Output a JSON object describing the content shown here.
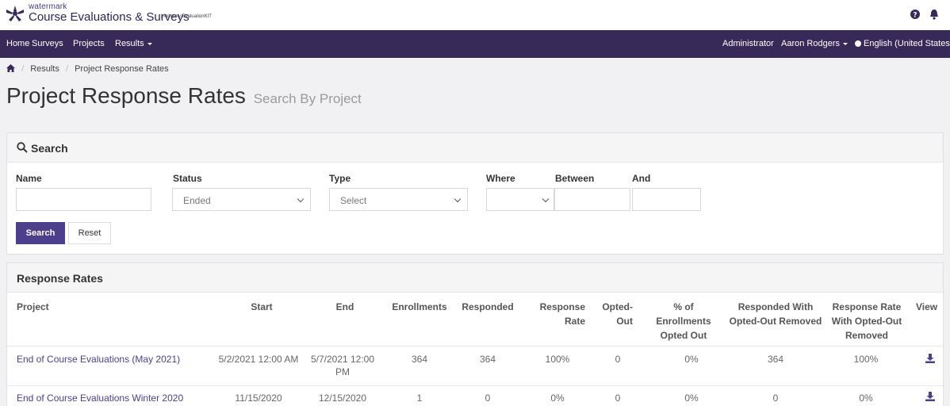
{
  "brand": {
    "small": "watermark",
    "name": "Course Evaluations & Surveys",
    "formerly": "| formerly EvaluationKIT"
  },
  "nav": {
    "items": [
      "Home",
      "Surveys",
      "Projects",
      "Results"
    ],
    "admin": "Administrator",
    "user": "Aaron Rodgers",
    "language": "English (United States)"
  },
  "breadcrumb": {
    "items": [
      "Results",
      "Project Response Rates"
    ]
  },
  "page": {
    "title": "Project Response Rates",
    "subtitle": "Search By Project"
  },
  "search": {
    "panel_title": "Search",
    "labels": {
      "name": "Name",
      "status": "Status",
      "type": "Type",
      "where": "Where",
      "between": "Between",
      "and": "And"
    },
    "values": {
      "name": "",
      "status": "Ended",
      "type": "Select",
      "where": "",
      "between": "",
      "and": ""
    },
    "search_button": "Search",
    "reset_button": "Reset"
  },
  "rates": {
    "panel_title": "Response Rates",
    "headers": {
      "project": "Project",
      "start": "Start",
      "end": "End",
      "enrollments": "Enrollments",
      "responded": "Responded",
      "response_rate": "Response Rate",
      "opted_out": "Opted-Out",
      "pct_opted_out": "% of Enrollments Opted Out",
      "responded_wo": "Responded With Opted-Out Removed",
      "rate_wo": "Response Rate With Opted-Out Removed",
      "view": "View"
    },
    "rows": [
      {
        "project": "End of Course Evaluations (May 2021)",
        "start": "5/2/2021 12:00 AM",
        "end": "5/7/2021 12:00 PM",
        "enrollments": "364",
        "responded": "364",
        "response_rate": "100%",
        "opted_out": "0",
        "pct_opted_out": "0%",
        "responded_wo": "364",
        "rate_wo": "100%"
      },
      {
        "project": "End of Course Evaluations Winter 2020",
        "start": "11/15/2020",
        "end": "12/15/2020",
        "enrollments": "1",
        "responded": "0",
        "response_rate": "0%",
        "opted_out": "0",
        "pct_opted_out": "0%",
        "responded_wo": "0",
        "rate_wo": "0%"
      }
    ]
  },
  "colors": {
    "nav_bg": "#382a58",
    "accent": "#4d3f8c",
    "page_bg": "#f1f1f3"
  },
  "icons": [
    "watermark-logo-icon",
    "help-icon",
    "bell-icon",
    "home-icon",
    "globe-icon",
    "search-icon",
    "download-icon"
  ]
}
